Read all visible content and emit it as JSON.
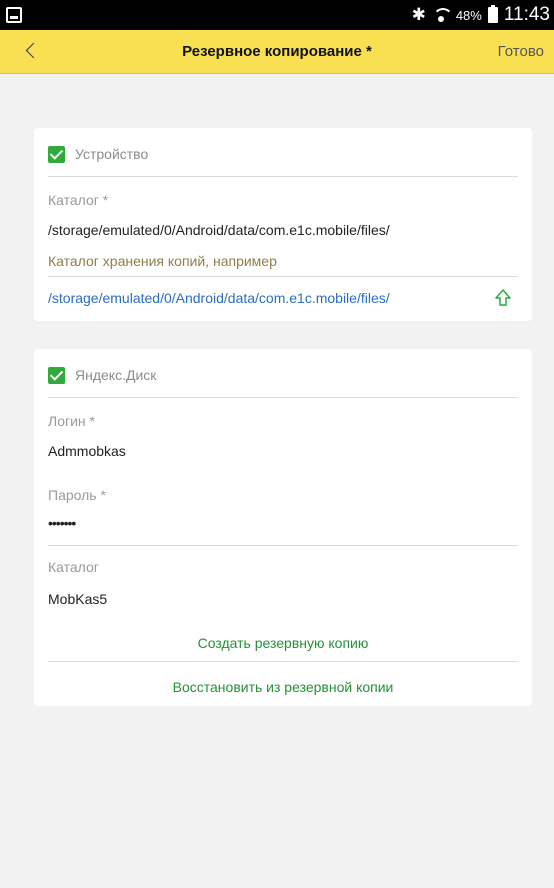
{
  "status_bar": {
    "battery": "48%",
    "time": "11:43"
  },
  "header": {
    "title": "Резервное копирование *",
    "done_label": "Готово"
  },
  "device_section": {
    "checkbox_label": "Устройство",
    "checked": true,
    "catalog_label": "Каталог *",
    "catalog_value": "/storage/emulated/0/Android/data/com.e1c.mobile/files/",
    "hint": "Каталог хранения копий, например",
    "example_path": "/storage/emulated/0/Android/data/com.e1c.mobile/files/"
  },
  "yandex_section": {
    "checkbox_label": "Яндекс.Диск",
    "checked": true,
    "login_label": "Логин *",
    "login_value": "Admmobkas",
    "password_label": "Пароль *",
    "password_value": "•••••••",
    "catalog_label": "Каталог",
    "catalog_value": "MobKas5"
  },
  "actions": {
    "create_backup": "Создать резервную копию",
    "restore_backup": "Восстановить из резервной копии"
  },
  "colors": {
    "topbar": "#f9df52",
    "check_green": "#2faa3b",
    "action_green": "#24913a",
    "link_blue": "#2a6fbf",
    "hint_brown": "#8f7e4a"
  }
}
